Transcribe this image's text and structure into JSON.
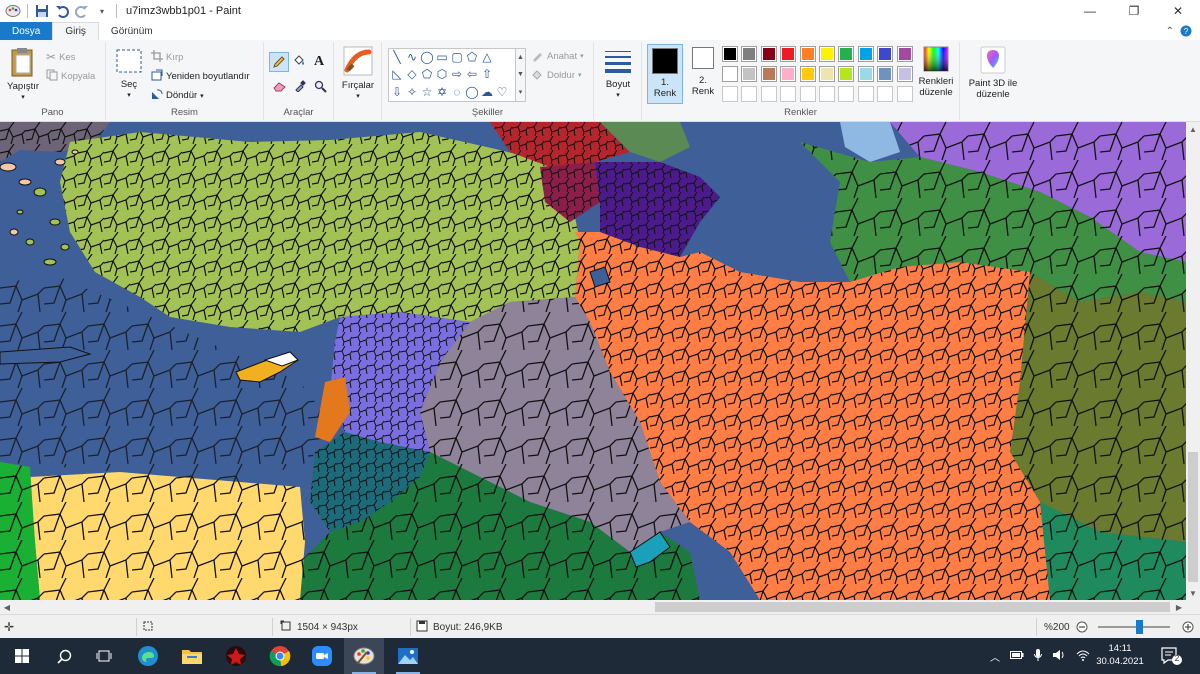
{
  "window": {
    "title": "u7imz3wbb1p01 - Paint",
    "minimize_glyph": "—",
    "maximize_glyph": "❐",
    "close_glyph": "✕"
  },
  "tabs": [
    {
      "label": "Dosya"
    },
    {
      "label": "Giriş"
    },
    {
      "label": "Görünüm"
    }
  ],
  "ribbon": {
    "pano": {
      "label": "Pano",
      "paste": "Yapıştır",
      "cut": "Kes",
      "copy": "Kopyala"
    },
    "resim": {
      "label": "Resim",
      "select": "Seç",
      "crop": "Kırp",
      "resize": "Yeniden boyutlandır",
      "rotate": "Döndür"
    },
    "araclar": {
      "label": "Araçlar"
    },
    "fircalar": {
      "label": "Fırçalar"
    },
    "sekiller": {
      "label": "Şekiller",
      "outline": "Anahat",
      "fill": "Doldur"
    },
    "boyut": {
      "label": "Boyut"
    },
    "renkler": {
      "label": "Renkler",
      "color1_line1": "1.",
      "color1_line2": "Renk",
      "color2_line1": "2.",
      "color2_line2": "Renk",
      "edit_colors_line1": "Renkleri",
      "edit_colors_line2": "düzenle",
      "paint3d_line1": "Paint 3D ile",
      "paint3d_line2": "düzenle",
      "color1_value": "#000000",
      "color2_value": "#ffffff",
      "palette_row1": [
        "#000000",
        "#7f7f7f",
        "#880015",
        "#ed1c24",
        "#ff7f27",
        "#fff200",
        "#22b14c",
        "#00a2e8",
        "#3f48cc",
        "#a349a4"
      ],
      "palette_row2": [
        "#ffffff",
        "#c3c3c3",
        "#b97a57",
        "#ffaec9",
        "#ffc90e",
        "#efe4b0",
        "#b5e61d",
        "#99d9ea",
        "#7092be",
        "#c8bfe7"
      ]
    }
  },
  "status": {
    "dimensions": "1504 × 943px",
    "size": "Boyut: 246,9KB",
    "zoom": "%200"
  },
  "taskbar": {
    "time": "14:11",
    "date": "30.04.2021",
    "notification_count": "2"
  }
}
